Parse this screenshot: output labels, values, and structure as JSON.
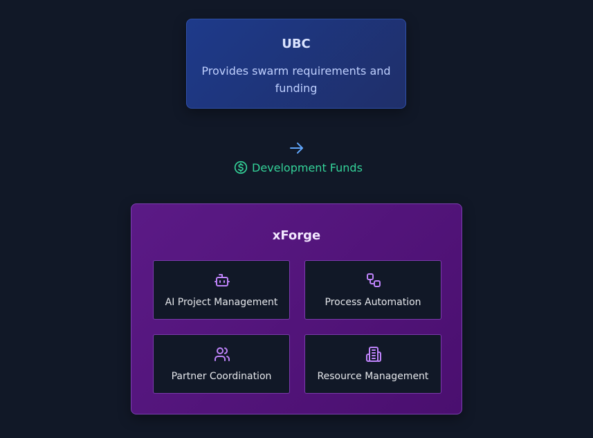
{
  "ubc": {
    "title": "UBC",
    "description": "Provides swarm requirements and funding"
  },
  "flow": {
    "arrow_icon": "arrow-right-icon",
    "funds_icon": "dollar-circle-icon",
    "label": "Development Funds"
  },
  "xforge": {
    "title": "xForge",
    "features": [
      {
        "label": "AI Project Management",
        "icon": "robot-icon"
      },
      {
        "label": "Process Automation",
        "icon": "workflow-icon"
      },
      {
        "label": "Partner Coordination",
        "icon": "users-icon"
      },
      {
        "label": "Resource Management",
        "icon": "building-icon"
      }
    ]
  },
  "colors": {
    "background": "#111827",
    "ubc_accent": "#1e3a8a",
    "xforge_accent": "#5b1a86",
    "funds_green": "#34d399",
    "arrow_blue": "#60a5fa",
    "icon_purple": "#c084fc"
  }
}
